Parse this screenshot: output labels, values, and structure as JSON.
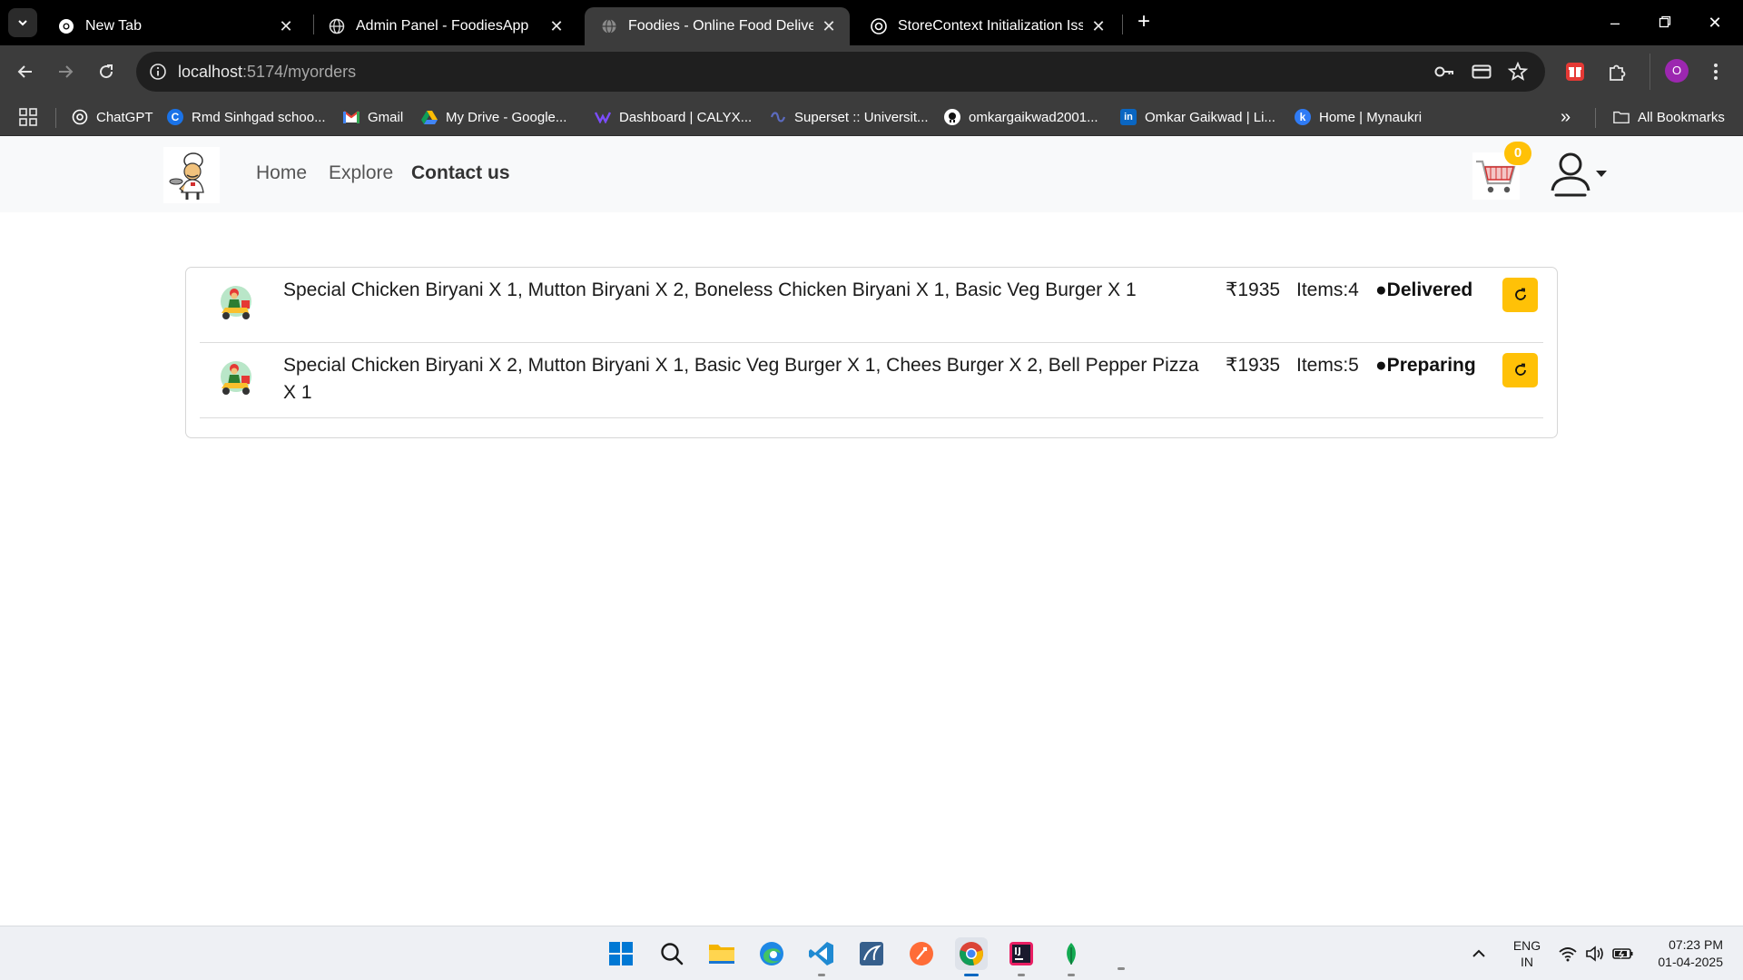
{
  "browser": {
    "tabs": [
      {
        "title": "New Tab",
        "active": false
      },
      {
        "title": "Admin Panel - FoodiesApp",
        "active": false
      },
      {
        "title": "Foodies - Online Food Delivery",
        "active": true
      },
      {
        "title": "StoreContext Initialization Issue",
        "active": false
      }
    ],
    "url_host": "localhost",
    "url_path": ":5174/myorders",
    "profile_initial": "O",
    "bookmarks": [
      "ChatGPT",
      "Rmd Sinhgad schoo...",
      "Gmail",
      "My Drive - Google...",
      "Dashboard | CALYX...",
      "Superset :: Universit...",
      "omkargaikwad2001...",
      "Omkar Gaikwad | Li...",
      "Home | Mynaukri"
    ],
    "overflow_label": "»",
    "all_bookmarks": "All Bookmarks"
  },
  "site": {
    "nav": {
      "home": "Home",
      "explore": "Explore",
      "contact": "Contact us"
    },
    "cart_count": "0"
  },
  "orders": [
    {
      "items": "Special Chicken Biryani X 1, Mutton Biryani X 2, Boneless Chicken Biryani X 1, Basic Veg Burger X 1",
      "amount": "₹1935",
      "count": "Items:4",
      "status": "●Delivered"
    },
    {
      "items": "Special Chicken Biryani X 2, Mutton Biryani X 1, Basic Veg Burger X 1, Chees Burger X 2, Bell Pepper Pizza X 1",
      "amount": "₹1935",
      "count": "Items:5",
      "status": "●Preparing"
    }
  ],
  "taskbar": {
    "lang_line1": "ENG",
    "lang_line2": "IN",
    "time": "07:23 PM",
    "date": "01-04-2025"
  }
}
